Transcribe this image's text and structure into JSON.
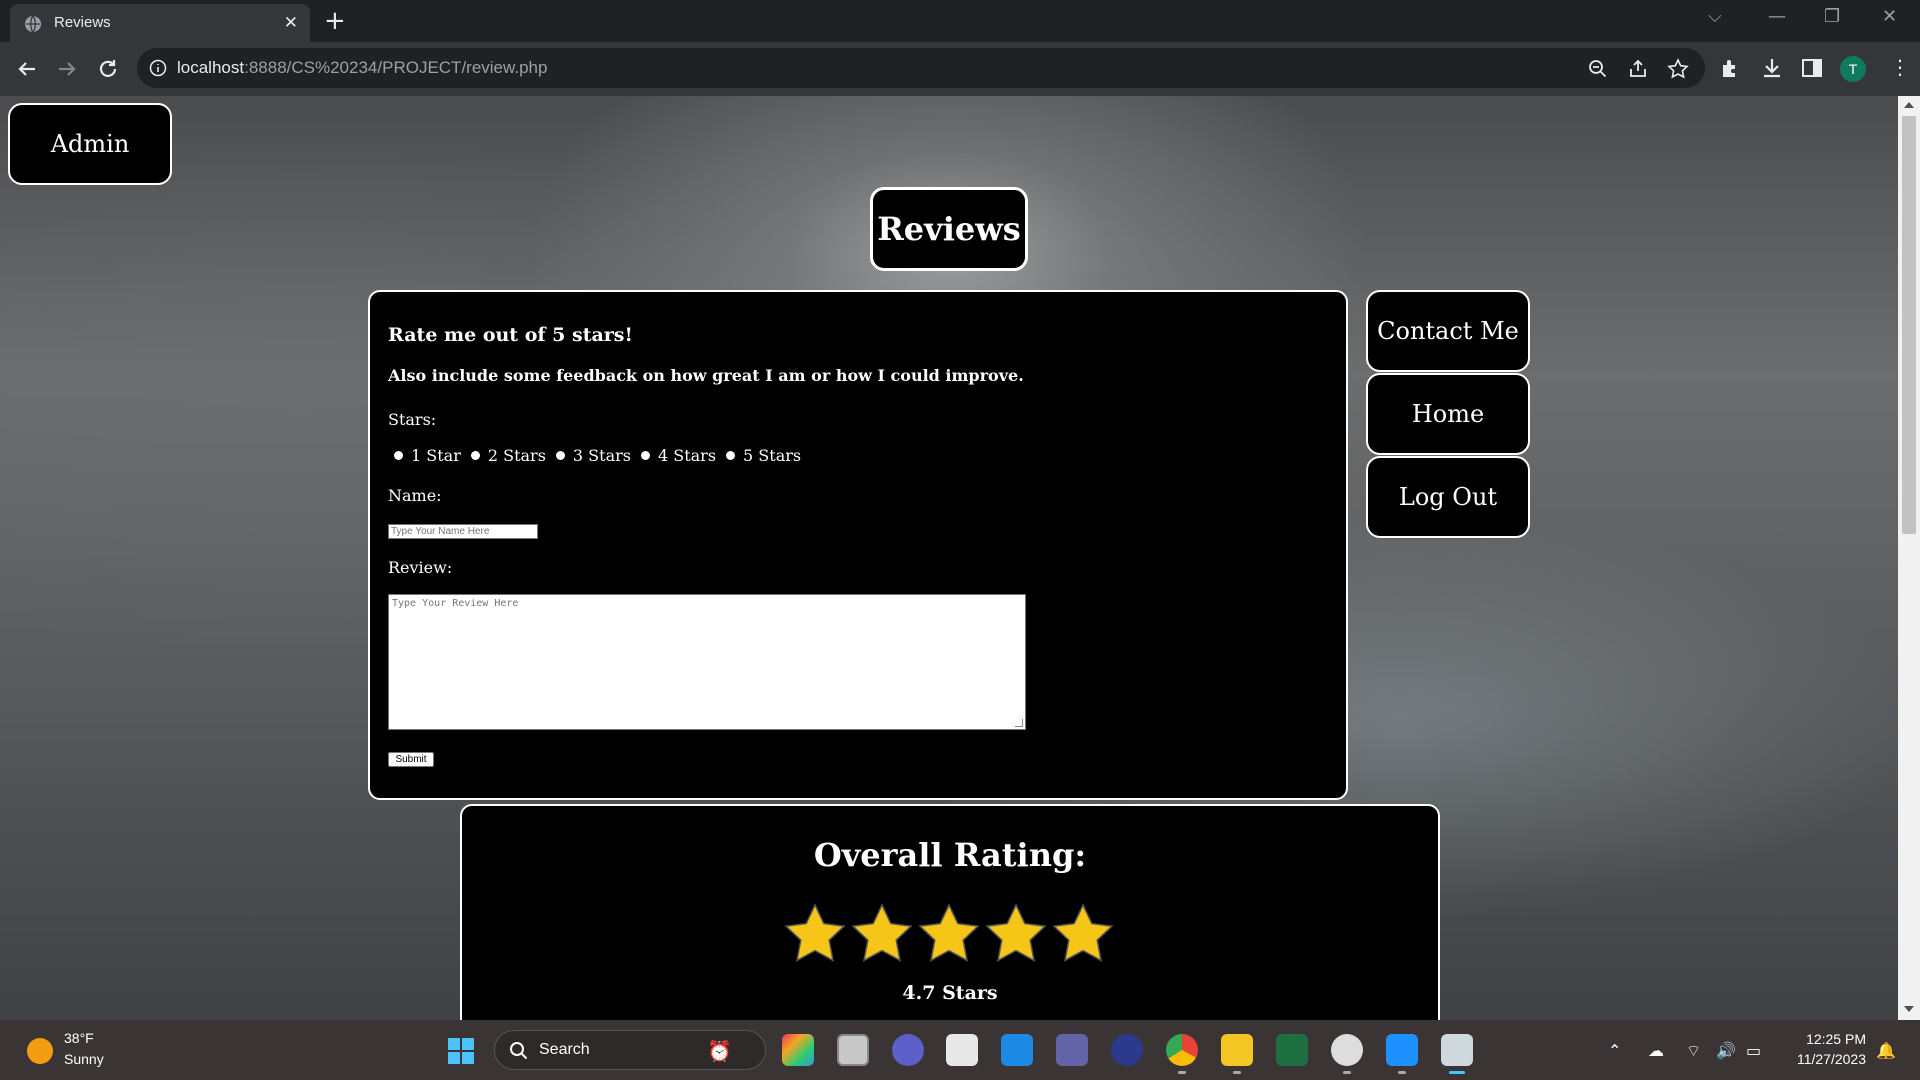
{
  "browser": {
    "tab_title": "Reviews",
    "url_host": "localhost",
    "url_rest": ":8888/CS%20234/PROJECT/review.php",
    "profile_initial": "T"
  },
  "page": {
    "admin_label": "Admin",
    "title": "Reviews",
    "nav": [
      {
        "label": "Contact Me"
      },
      {
        "label": "Home"
      },
      {
        "label": "Log Out"
      }
    ],
    "form": {
      "heading": "Rate me out of 5 stars!",
      "subheading": "Also include some feedback on how great I am or how I could improve.",
      "stars_label": "Stars:",
      "star_options": [
        "1 Star",
        "2 Stars",
        "3 Stars",
        "4 Stars",
        "5 Stars"
      ],
      "name_label": "Name:",
      "name_placeholder": "Type Your Name Here",
      "review_label": "Review:",
      "review_placeholder": "Type Your Review Here",
      "submit_label": "Submit"
    },
    "rating": {
      "title": "Overall Rating:",
      "star_count": 5,
      "value_text": "4.7 Stars",
      "star_color": "#f5c518"
    }
  },
  "taskbar": {
    "weather_temp": "38°F",
    "weather_desc": "Sunny",
    "search_label": "Search",
    "time": "12:25 PM",
    "date": "11/27/2023"
  }
}
